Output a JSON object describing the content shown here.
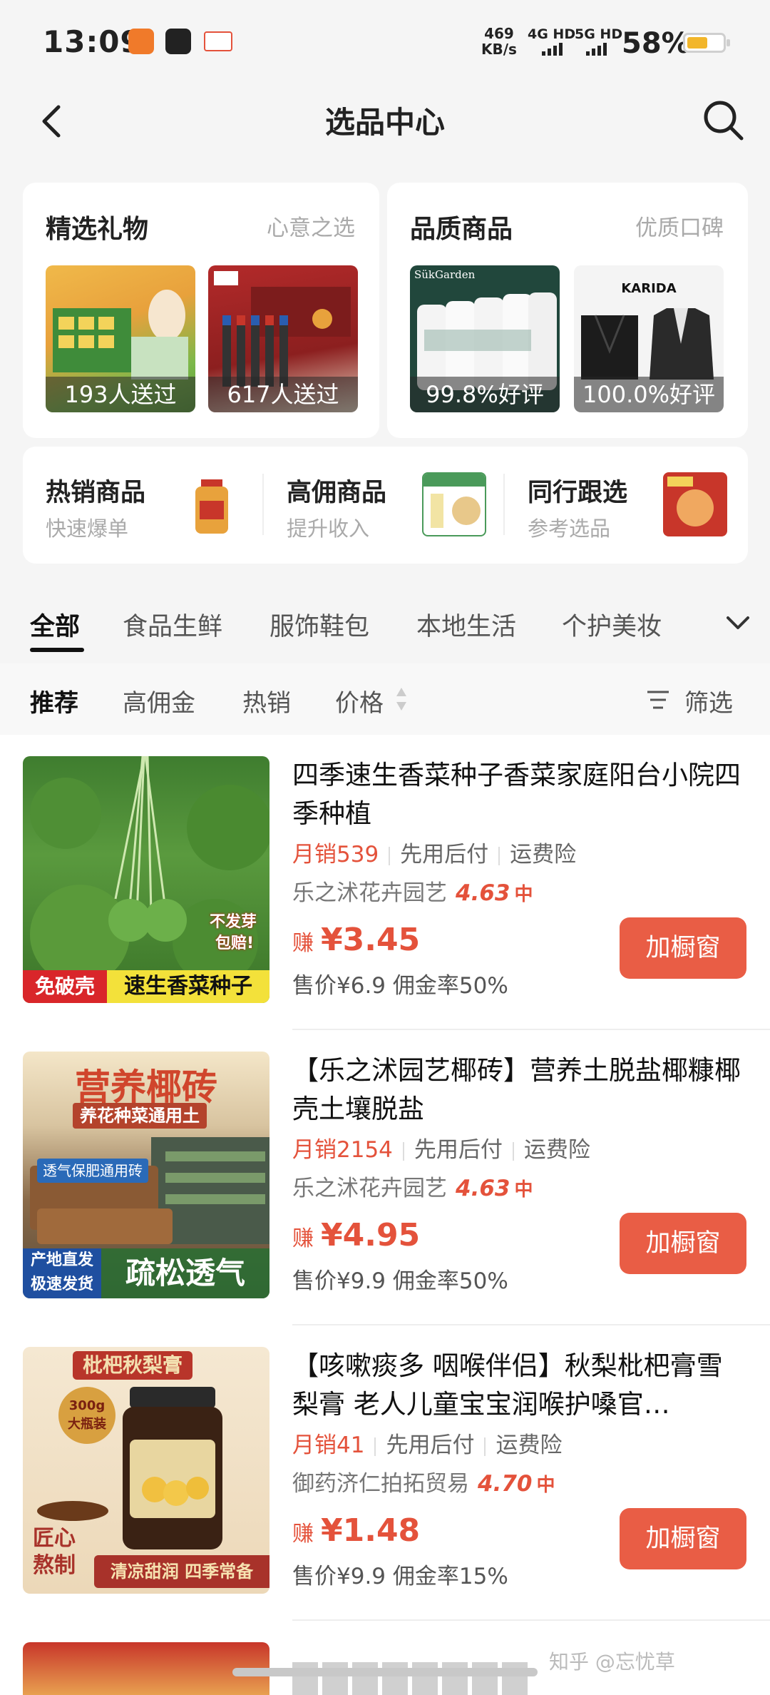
{
  "status_bar": {
    "time": "13:09",
    "net_speed_value": "469",
    "net_speed_unit": "KB/s",
    "sim1": "4G HD",
    "sim2": "5G HD",
    "battery": "58%",
    "battery_level": 0.58
  },
  "header": {
    "title": "选品中心"
  },
  "gift_card": {
    "title": "精选礼物",
    "subtitle": "心意之选",
    "items": [
      {
        "caption": "193人送过"
      },
      {
        "caption": "617人送过"
      }
    ]
  },
  "quality_card": {
    "title": "品质商品",
    "subtitle": "优质口碑",
    "items": [
      {
        "caption": "99.8%好评",
        "brand": "SükGarden"
      },
      {
        "caption": "100.0%好评",
        "brand": "KARIDA"
      }
    ]
  },
  "shortcuts": [
    {
      "title": "热销商品",
      "subtitle": "快速爆单"
    },
    {
      "title": "高佣商品",
      "subtitle": "提升收入"
    },
    {
      "title": "同行跟选",
      "subtitle": "参考选品"
    }
  ],
  "categories": [
    "全部",
    "食品生鲜",
    "服饰鞋包",
    "本地生活",
    "个护美妆"
  ],
  "sorts": {
    "recommend": "推荐",
    "high_commission": "高佣金",
    "hot": "热销",
    "price": "价格",
    "filter": "筛选"
  },
  "products": [
    {
      "title": "四季速生香菜种子香菜家庭阳台小院四季种植",
      "sales": "月销539",
      "tag1": "先用后付",
      "tag2": "运费险",
      "shop": "乐之沭花卉园艺",
      "score": "4.63",
      "level": "中",
      "earn_label": "赚",
      "earn": "¥3.45",
      "price_line": "售价¥6.9  佣金率50%",
      "button": "加橱窗",
      "img_text1": "免破壳",
      "img_text2": "速生香菜种子",
      "img_text3": "不发芽",
      "img_text4": "包赔!"
    },
    {
      "title": "【乐之沭园艺椰砖】营养土脱盐椰糠椰壳土壤脱盐",
      "sales": "月销2154",
      "tag1": "先用后付",
      "tag2": "运费险",
      "shop": "乐之沭花卉园艺",
      "score": "4.63",
      "level": "中",
      "earn_label": "赚",
      "earn": "¥4.95",
      "price_line": "售价¥9.9  佣金率50%",
      "button": "加橱窗",
      "img_text1": "营养椰砖",
      "img_text2": "养花种菜通用土",
      "img_text3": "透气保肥通用砖",
      "img_text4": "产地直发",
      "img_text5": "极速发货",
      "img_text6": "疏松透气"
    },
    {
      "title": "【咳嗽痰多 咽喉伴侣】秋梨枇杷膏雪梨膏 老人儿童宝宝润喉护嗓官…",
      "sales": "月销41",
      "tag1": "先用后付",
      "tag2": "运费险",
      "shop": "御药济仁拍拓贸易",
      "score": "4.70",
      "level": "中",
      "earn_label": "赚",
      "earn": "¥1.48",
      "price_line": "售价¥9.9  佣金率15%",
      "button": "加橱窗",
      "img_text1": "枇杷秋梨膏",
      "img_text2": "300g",
      "img_text3": "大瓶装",
      "img_text4": "匠心",
      "img_text5": "熬制",
      "img_text6": "清凉甜润 四季常备"
    }
  ],
  "watermark": "知乎 @忘忧草"
}
